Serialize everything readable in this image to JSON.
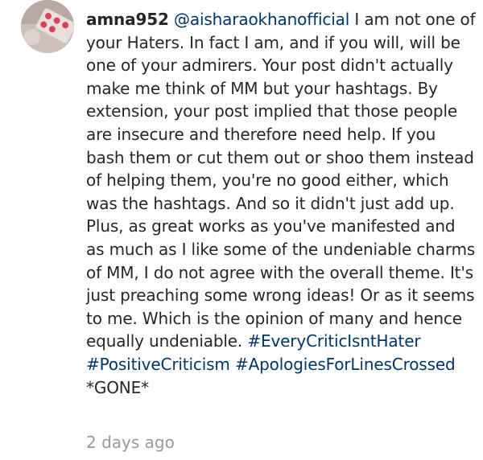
{
  "comment": {
    "username": "amna952",
    "mention": "@aisharaokhanofficial",
    "text": "I am not one of your Haters. In fact I am, and if you will, will be one of your admirers. Your post didn't actually make me think of MM but your hashtags. By extension, your post implied that those people are insecure and therefore need help. If you bash them or cut them out or shoo them instead of helping them, you're no good either, which was the hashtags. And so it didn't just add up. Plus, as great works as you've manifested and as much as I like some of the undeniable charms of MM, I do not agree with the overall theme. It's just preaching some wrong ideas! Or as it seems to me. Which is the opinion of many and hence equally undeniable.",
    "hashtags": [
      "#EveryCriticIsntHater",
      "#PositiveCriticism",
      "#ApologiesForLinesCrossed"
    ],
    "suffix": "*GONE*",
    "timestamp": "2 days ago"
  },
  "colors": {
    "text": "#262626",
    "link": "#003569",
    "timestamp": "#999999"
  }
}
